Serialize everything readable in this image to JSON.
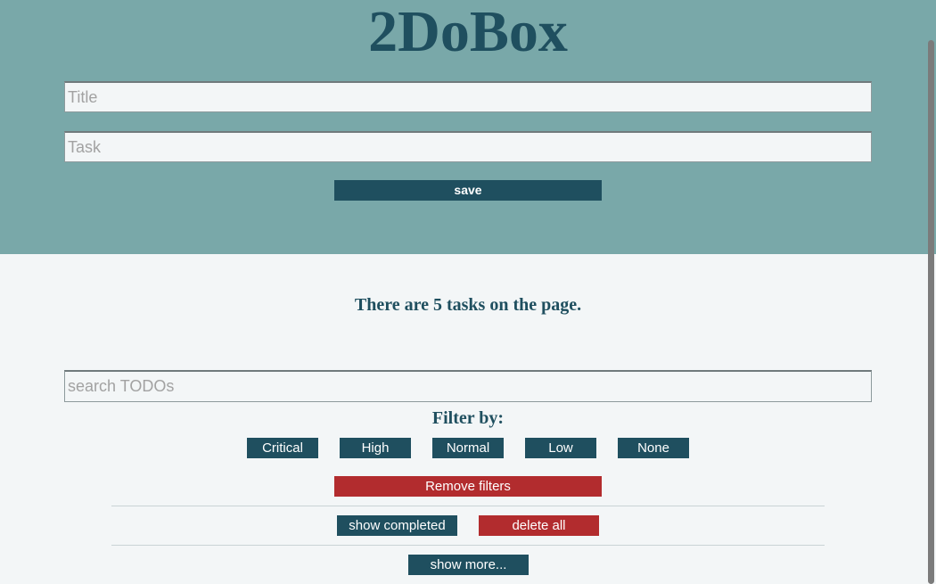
{
  "header": {
    "app_title": "2DoBox",
    "title_placeholder": "Title",
    "task_placeholder": "Task",
    "save_label": "save"
  },
  "main": {
    "task_count_text": "There are 5 tasks on the page.",
    "search_placeholder": "search TODOs",
    "filter_label": "Filter by:",
    "filters": [
      "Critical",
      "High",
      "Normal",
      "Low",
      "None"
    ],
    "remove_filters_label": "Remove filters",
    "show_completed_label": "show completed",
    "delete_all_label": "delete all",
    "show_more_label": "show more..."
  },
  "colors": {
    "header_bg": "#79a8a9",
    "page_bg": "#f3f6f7",
    "primary": "#1f4f5f",
    "danger": "#b22c2e"
  }
}
